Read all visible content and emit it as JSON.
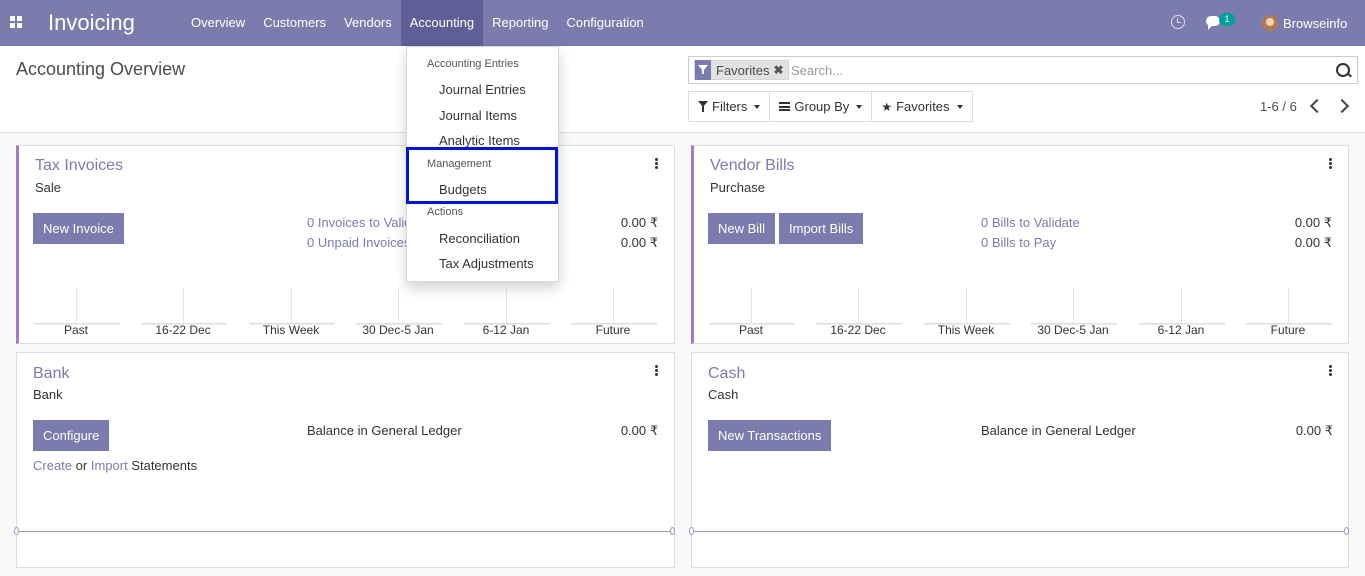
{
  "navbar": {
    "app_title": "Invoicing",
    "menu": [
      "Overview",
      "Customers",
      "Vendors",
      "Accounting",
      "Reporting",
      "Configuration"
    ],
    "active_menu": "Accounting",
    "chat_badge": "1",
    "user_name": "Browseinfo"
  },
  "control_panel": {
    "breadcrumb": "Accounting Overview",
    "search": {
      "facet_label": "Favorites",
      "placeholder": "Search..."
    },
    "filters_label": "Filters",
    "group_by_label": "Group By",
    "favorites_label": "Favorites",
    "pager": "1-6 / 6"
  },
  "accounting_menu": {
    "sections": [
      {
        "header": "Accounting Entries",
        "items": [
          "Journal Entries",
          "Journal Items",
          "Analytic Items"
        ]
      },
      {
        "header": "Management",
        "items": [
          "Budgets"
        ]
      },
      {
        "header": "Actions",
        "items": [
          "Reconciliation",
          "Tax Adjustments"
        ]
      }
    ],
    "highlighted_section": "Management"
  },
  "dashboard": {
    "tax_invoices": {
      "title": "Tax Invoices",
      "subtitle": "Sale",
      "button": "New Invoice",
      "stats": [
        {
          "label": "0 Invoices to Validate",
          "amount": "0.00 ₹"
        },
        {
          "label": "0 Unpaid Invoices",
          "amount": "0.00 ₹"
        }
      ],
      "chart_ticks": [
        "Past",
        "16-22 Dec",
        "This Week",
        "30 Dec-5 Jan",
        "6-12 Jan",
        "Future"
      ]
    },
    "vendor_bills": {
      "title": "Vendor Bills",
      "subtitle": "Purchase",
      "buttons": [
        "New Bill",
        "Import Bills"
      ],
      "stats": [
        {
          "label": "0 Bills to Validate",
          "amount": "0.00 ₹"
        },
        {
          "label": "0 Bills to Pay",
          "amount": "0.00 ₹"
        }
      ],
      "chart_ticks": [
        "Past",
        "16-22 Dec",
        "This Week",
        "30 Dec-5 Jan",
        "6-12 Jan",
        "Future"
      ]
    },
    "bank": {
      "title": "Bank",
      "subtitle": "Bank",
      "button": "Configure",
      "balance_label": "Balance in General Ledger",
      "balance_amount": "0.00 ₹",
      "create_link": "Create",
      "or_text": "or",
      "import_link": "Import",
      "statements_text": "Statements"
    },
    "cash": {
      "title": "Cash",
      "subtitle": "Cash",
      "button": "New Transactions",
      "balance_label": "Balance in General Ledger",
      "balance_amount": "0.00 ₹"
    }
  },
  "colors": {
    "brand": "#7c7bad",
    "highlight_box": "#0015d6",
    "accent_border": "#9f7ec6"
  },
  "icons": [
    "apps-icon",
    "clock-icon",
    "chat-icon",
    "avatar",
    "filter-icon",
    "close-icon",
    "search-icon",
    "list-icon",
    "star-icon",
    "chevron-left-icon",
    "chevron-right-icon",
    "kebab-icon"
  ]
}
